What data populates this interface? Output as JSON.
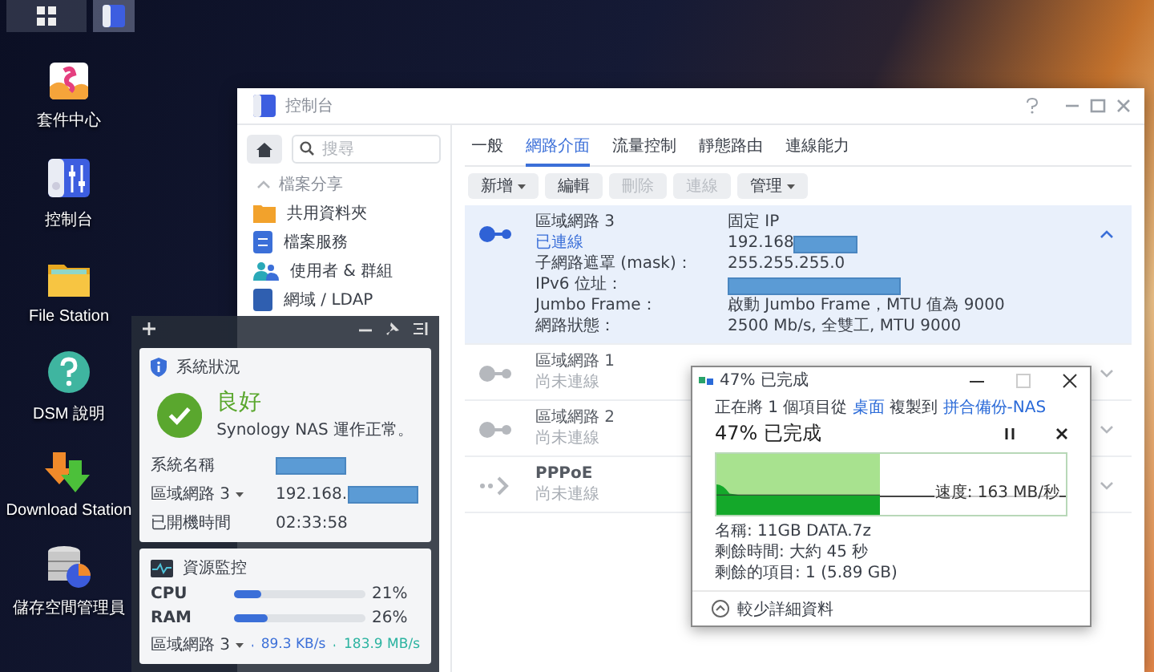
{
  "taskbar": {
    "buttons": [
      {
        "kind": "grid",
        "selected": false
      },
      {
        "kind": "control-panel",
        "selected": true
      }
    ]
  },
  "desktop_icons": [
    {
      "kind": "package",
      "label": "套件中心"
    },
    {
      "kind": "control-panel",
      "label": "控制台"
    },
    {
      "kind": "folder",
      "label": "File Station"
    },
    {
      "kind": "help",
      "label": "DSM 說明"
    },
    {
      "kind": "download",
      "label": "Download Station"
    },
    {
      "kind": "storage",
      "label": "儲存空間管理員"
    }
  ],
  "control_panel": {
    "title": "控制台",
    "search": {
      "placeholder": "搜尋"
    },
    "section": {
      "label": "檔案分享",
      "expanded": true
    },
    "sidebar_items": [
      {
        "kind": "folder",
        "label": "共用資料夾"
      },
      {
        "kind": "sync",
        "label": "檔案服務"
      },
      {
        "kind": "users",
        "label": "使用者 & 群組"
      },
      {
        "kind": "domain",
        "label": "網域 / LDAP"
      }
    ],
    "tabs": [
      {
        "label": "一般",
        "selected": false
      },
      {
        "label": "網路介面",
        "selected": true
      },
      {
        "label": "流量控制",
        "selected": false
      },
      {
        "label": "靜態路由",
        "selected": false
      },
      {
        "label": "連線能力",
        "selected": false
      }
    ],
    "toolbar": [
      {
        "label": "新增",
        "dropdown": true,
        "disabled": false
      },
      {
        "label": "編輯",
        "dropdown": false,
        "disabled": false
      },
      {
        "label": "刪除",
        "dropdown": false,
        "disabled": true
      },
      {
        "label": "連線",
        "dropdown": false,
        "disabled": true
      },
      {
        "label": "管理",
        "dropdown": true,
        "disabled": false
      }
    ],
    "interfaces": [
      {
        "kind": "lan",
        "name": "區域網路 3",
        "status": "已連線",
        "connected": true,
        "expanded": true,
        "ip_mode": "固定 IP",
        "ip": {
          "value": "192.168",
          "redacted": true
        },
        "details": [
          {
            "label": "子網路遮罩 (mask)：",
            "value": "255.255.255.0",
            "redacted": false
          },
          {
            "label": "IPv6 位址：",
            "redacted": true
          },
          {
            "label": "Jumbo Frame：",
            "value": "啟動 Jumbo Frame，MTU 值為 9000",
            "redacted": false
          },
          {
            "label": "網路狀態：",
            "value": "2500 Mb/s, 全雙工, MTU 9000",
            "redacted": false
          }
        ]
      },
      {
        "kind": "lan",
        "name": "區域網路 1",
        "status": "尚未連線",
        "connected": false,
        "expanded": false
      },
      {
        "kind": "lan",
        "name": "區域網路 2",
        "status": "尚未連線",
        "connected": false,
        "expanded": false
      },
      {
        "kind": "pppoe",
        "name": "PPPoE",
        "status": "尚未連線",
        "connected": false,
        "expanded": false
      }
    ]
  },
  "widgets": {
    "system": {
      "title": "系統狀況",
      "status": "良好",
      "message": "Synology NAS 運作正常。",
      "rows": [
        {
          "label": "系統名稱",
          "dropdown": false,
          "redacted": true
        },
        {
          "label": "區域網路 3",
          "value": "192.168.",
          "dropdown": true,
          "redacted": true
        },
        {
          "label": "已開機時間",
          "value": "02:33:58",
          "dropdown": false,
          "redacted": false
        }
      ]
    },
    "resources": {
      "title": "資源監控",
      "meters": [
        {
          "label": "CPU",
          "level": 0.21,
          "reading": "21%"
        },
        {
          "label": "RAM",
          "level": 0.26,
          "reading": "26%"
        }
      ],
      "network": {
        "label": "區域網路 3",
        "upload": "89.3 KB/s",
        "download": "183.9 MB/s"
      }
    }
  },
  "copy_dialog": {
    "title": "47% 已完成",
    "prefix": "正在將 1 個項目從",
    "source": "桌面",
    "middle": "複製到",
    "destination": "拼合備份-NAS",
    "heading": "47% 已完成",
    "level": 0.47,
    "speed": "速度: 163 MB/秒",
    "details": [
      "名稱: 11GB DATA.7z",
      "剩餘時間: 大約 45 秒",
      "剩餘的項目: 1 (5.89 GB)"
    ],
    "toggle": "較少詳細資料"
  }
}
